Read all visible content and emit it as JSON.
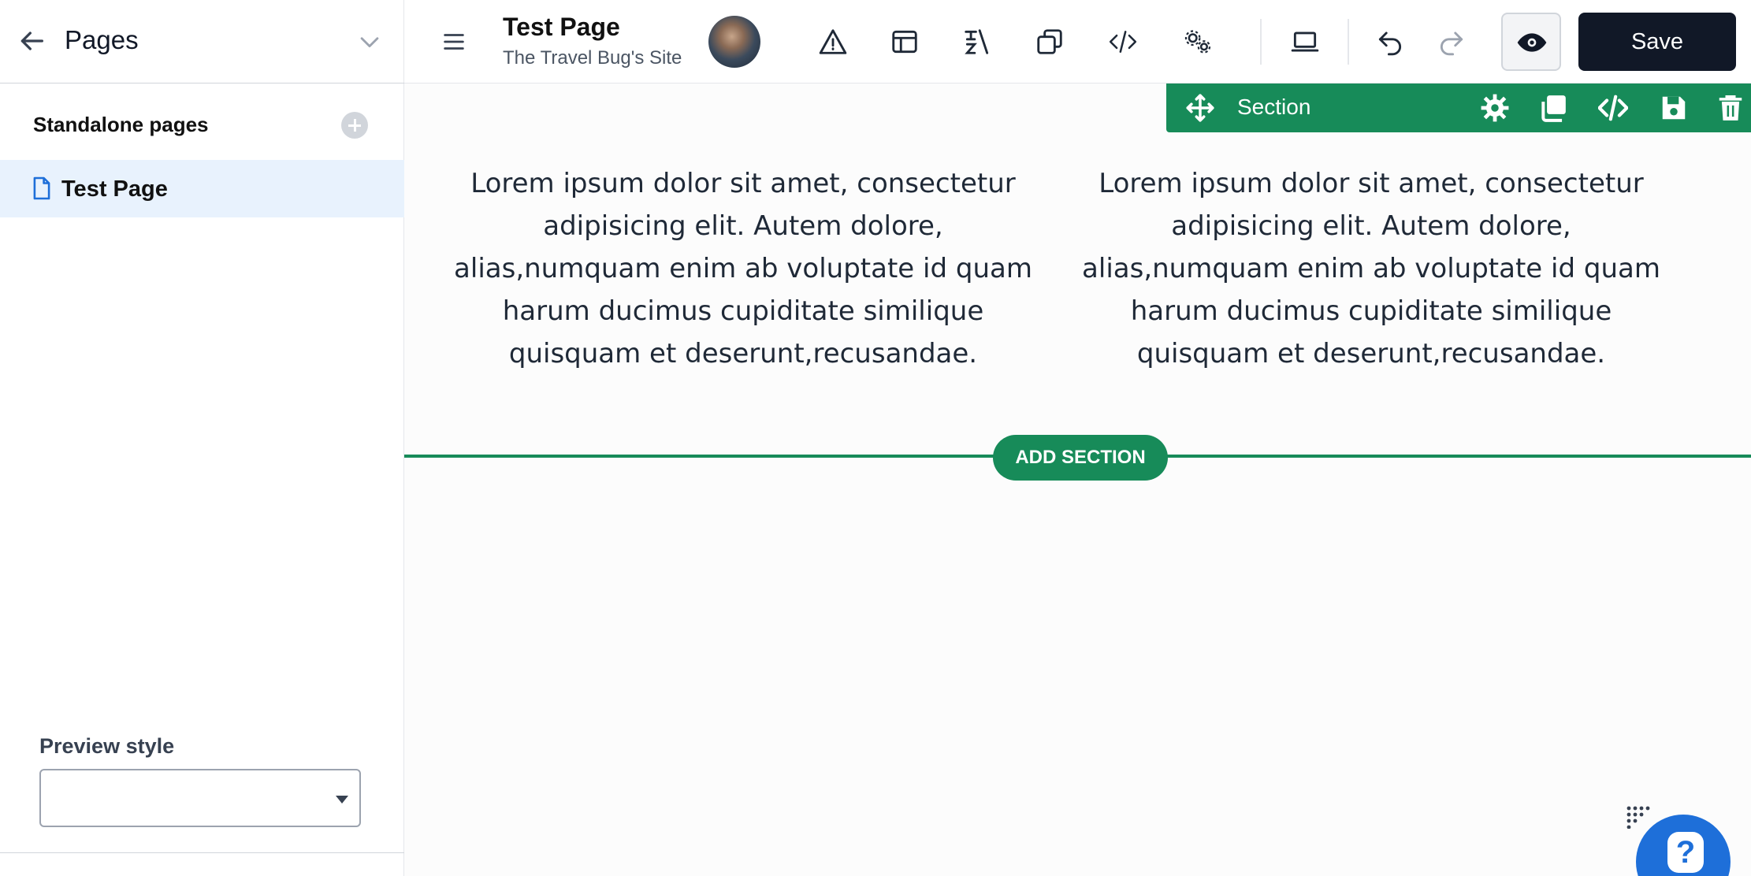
{
  "sidebar": {
    "title": "Pages",
    "section_title": "Standalone pages",
    "pages": [
      {
        "label": "Test Page"
      }
    ],
    "preview_style_label": "Preview style",
    "preview_style_value": ""
  },
  "topbar": {
    "page_title": "Test Page",
    "site_name": "The Travel Bug's Site",
    "save_label": "Save",
    "icons": [
      "menu-icon",
      "warning-icon",
      "layout-icon",
      "translate-icon",
      "copy-icon",
      "code-icon",
      "settings-icon",
      "laptop-icon",
      "undo-icon",
      "redo-icon",
      "eye-icon"
    ]
  },
  "section_toolbar": {
    "label": "Section",
    "icons": [
      "move-icon",
      "gear-icon",
      "duplicate-icon",
      "code-icon",
      "save-icon",
      "trash-icon"
    ]
  },
  "content": {
    "columns": [
      {
        "text": "Lorem ipsum dolor sit amet, consectetur adipisicing elit. Autem dolore, alias,numquam enim ab voluptate id quam harum ducimus cupiditate similique quisquam et deserunt,recusandae."
      },
      {
        "text": "Lorem ipsum dolor sit amet, consectetur adipisicing elit. Autem dolore, alias,numquam enim ab voluptate id quam harum ducimus cupiditate similique quisquam et deserunt,recusandae."
      }
    ],
    "add_section_label": "ADD SECTION"
  },
  "colors": {
    "accent_green": "#178b59",
    "save_bg": "#111827",
    "selected_bg": "#e8f2fd",
    "help_blue": "#1e6fd9"
  }
}
